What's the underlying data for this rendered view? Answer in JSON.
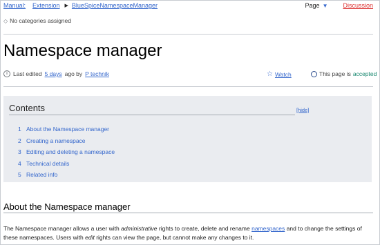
{
  "breadcrumb": {
    "items": [
      "Manual:",
      "Extension",
      "BlueSpiceNamespaceManager"
    ]
  },
  "page_actions": {
    "page": "Page",
    "discussion": "Discussion"
  },
  "categories": {
    "text": "No categories assigned"
  },
  "title": "Namespace manager",
  "meta": {
    "prefix": "Last edited",
    "when": "5 days",
    "ago": "ago by",
    "user": "P technik",
    "watch": "Watch",
    "status_prefix": "This page is",
    "status_word": "accepted"
  },
  "toc": {
    "title": "Contents",
    "hide": "[hide]",
    "items": [
      {
        "num": "1",
        "text": "About the Namespace manager"
      },
      {
        "num": "2",
        "text": "Creating a namespace"
      },
      {
        "num": "3",
        "text": "Editing and deleting a namespace"
      },
      {
        "num": "4",
        "text": "Technical details"
      },
      {
        "num": "5",
        "text": "Related info"
      }
    ]
  },
  "section": {
    "heading": "About the Namespace manager",
    "p1": "The Namespace manager allows a user with ",
    "p2": "administrative",
    "p3": " rights to create, delete and rename ",
    "link": "namespaces",
    "p4": " and to change the settings of these namespaces. Users with ",
    "p5": "edit",
    "p6": " rights can view the page, but cannot make any changes to it."
  },
  "colors": {
    "link": "#3366cc",
    "discussion": "#d33333",
    "accepted": "#14866d",
    "toc_bg": "#eaecf0"
  }
}
